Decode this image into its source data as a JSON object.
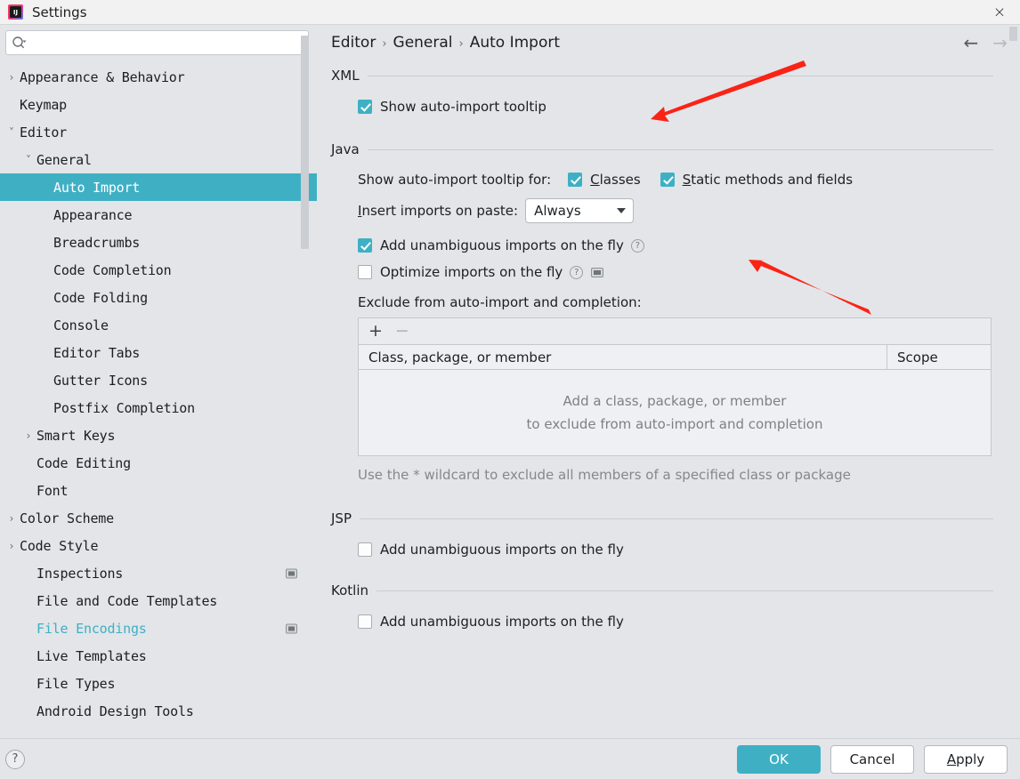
{
  "window": {
    "title": "Settings",
    "app_icon": "intellij-idea-icon",
    "close_label": "×"
  },
  "search": {
    "placeholder": "",
    "value": "",
    "icon": "search-icon"
  },
  "sidebar": {
    "items": [
      {
        "label": "Appearance & Behavior",
        "indent": 0,
        "arrow": "›",
        "selected": false,
        "modified": false,
        "badge": false
      },
      {
        "label": "Keymap",
        "indent": 0,
        "arrow": "",
        "selected": false,
        "modified": false,
        "badge": false
      },
      {
        "label": "Editor",
        "indent": 0,
        "arrow": "˅",
        "selected": false,
        "modified": false,
        "badge": false
      },
      {
        "label": "General",
        "indent": 1,
        "arrow": "˅",
        "selected": false,
        "modified": false,
        "badge": false
      },
      {
        "label": "Auto Import",
        "indent": 2,
        "arrow": "",
        "selected": true,
        "modified": false,
        "badge": false
      },
      {
        "label": "Appearance",
        "indent": 2,
        "arrow": "",
        "selected": false,
        "modified": false,
        "badge": false
      },
      {
        "label": "Breadcrumbs",
        "indent": 2,
        "arrow": "",
        "selected": false,
        "modified": false,
        "badge": false
      },
      {
        "label": "Code Completion",
        "indent": 2,
        "arrow": "",
        "selected": false,
        "modified": false,
        "badge": false
      },
      {
        "label": "Code Folding",
        "indent": 2,
        "arrow": "",
        "selected": false,
        "modified": false,
        "badge": false
      },
      {
        "label": "Console",
        "indent": 2,
        "arrow": "",
        "selected": false,
        "modified": false,
        "badge": false
      },
      {
        "label": "Editor Tabs",
        "indent": 2,
        "arrow": "",
        "selected": false,
        "modified": false,
        "badge": false
      },
      {
        "label": "Gutter Icons",
        "indent": 2,
        "arrow": "",
        "selected": false,
        "modified": false,
        "badge": false
      },
      {
        "label": "Postfix Completion",
        "indent": 2,
        "arrow": "",
        "selected": false,
        "modified": false,
        "badge": false
      },
      {
        "label": "Smart Keys",
        "indent": 1,
        "arrow": "›",
        "selected": false,
        "modified": false,
        "badge": false
      },
      {
        "label": "Code Editing",
        "indent": 1,
        "arrow": "",
        "selected": false,
        "modified": false,
        "badge": false
      },
      {
        "label": "Font",
        "indent": 1,
        "arrow": "",
        "selected": false,
        "modified": false,
        "badge": false
      },
      {
        "label": "Color Scheme",
        "indent": 0,
        "arrow": "›",
        "selected": false,
        "modified": false,
        "badge": false
      },
      {
        "label": "Code Style",
        "indent": 0,
        "arrow": "›",
        "selected": false,
        "modified": false,
        "badge": false
      },
      {
        "label": "Inspections",
        "indent": 1,
        "arrow": "",
        "selected": false,
        "modified": false,
        "badge": true
      },
      {
        "label": "File and Code Templates",
        "indent": 1,
        "arrow": "",
        "selected": false,
        "modified": false,
        "badge": false
      },
      {
        "label": "File Encodings",
        "indent": 1,
        "arrow": "",
        "selected": false,
        "modified": true,
        "badge": true
      },
      {
        "label": "Live Templates",
        "indent": 1,
        "arrow": "",
        "selected": false,
        "modified": false,
        "badge": false
      },
      {
        "label": "File Types",
        "indent": 1,
        "arrow": "",
        "selected": false,
        "modified": false,
        "badge": false
      },
      {
        "label": "Android Design Tools",
        "indent": 1,
        "arrow": "",
        "selected": false,
        "modified": false,
        "badge": false
      }
    ]
  },
  "breadcrumb": {
    "parts": [
      "Editor",
      "General",
      "Auto Import"
    ],
    "separator": "›",
    "back_icon": "←",
    "forward_icon": "→"
  },
  "sections": {
    "xml": {
      "title": "XML",
      "show_tooltip": {
        "label": "Show auto-import tooltip",
        "checked": true
      }
    },
    "java": {
      "title": "Java",
      "tooltip_for_label": "Show auto-import tooltip for:",
      "classes": {
        "label": "Classes",
        "mnemonic": "C",
        "checked": true
      },
      "static_methods": {
        "label": "Static methods and fields",
        "mnemonic": "S",
        "checked": true
      },
      "insert_imports_label": "Insert imports on paste:",
      "insert_imports_mnemonic": "I",
      "insert_imports_value": "Always",
      "add_unambiguous": {
        "label": "Add unambiguous imports on the fly",
        "checked": true,
        "help": "?"
      },
      "optimize_imports": {
        "label": "Optimize imports on the fly",
        "checked": false,
        "help": "?",
        "badge": true
      },
      "exclude_label": "Exclude from auto-import and completion:",
      "table": {
        "add_icon": "+",
        "remove_icon": "−",
        "columns": [
          "Class, package, or member",
          "Scope"
        ],
        "empty_lines": [
          "Add a class, package, or member",
          "to exclude from auto-import and completion"
        ]
      },
      "hint": "Use the * wildcard to exclude all members of a specified class or package"
    },
    "jsp": {
      "title": "JSP",
      "add_unambiguous": {
        "label": "Add unambiguous imports on the fly",
        "checked": false
      }
    },
    "kotlin": {
      "title": "Kotlin",
      "add_unambiguous": {
        "label": "Add unambiguous imports on the fly",
        "checked": false
      }
    }
  },
  "footer": {
    "help_label": "?",
    "ok_label": "OK",
    "cancel_label": "Cancel",
    "apply_label": "Apply",
    "apply_mnemonic": "A"
  },
  "colors": {
    "accent": "#3fb0c4",
    "background": "#e3e5e9",
    "annotation": "#fa2416"
  }
}
